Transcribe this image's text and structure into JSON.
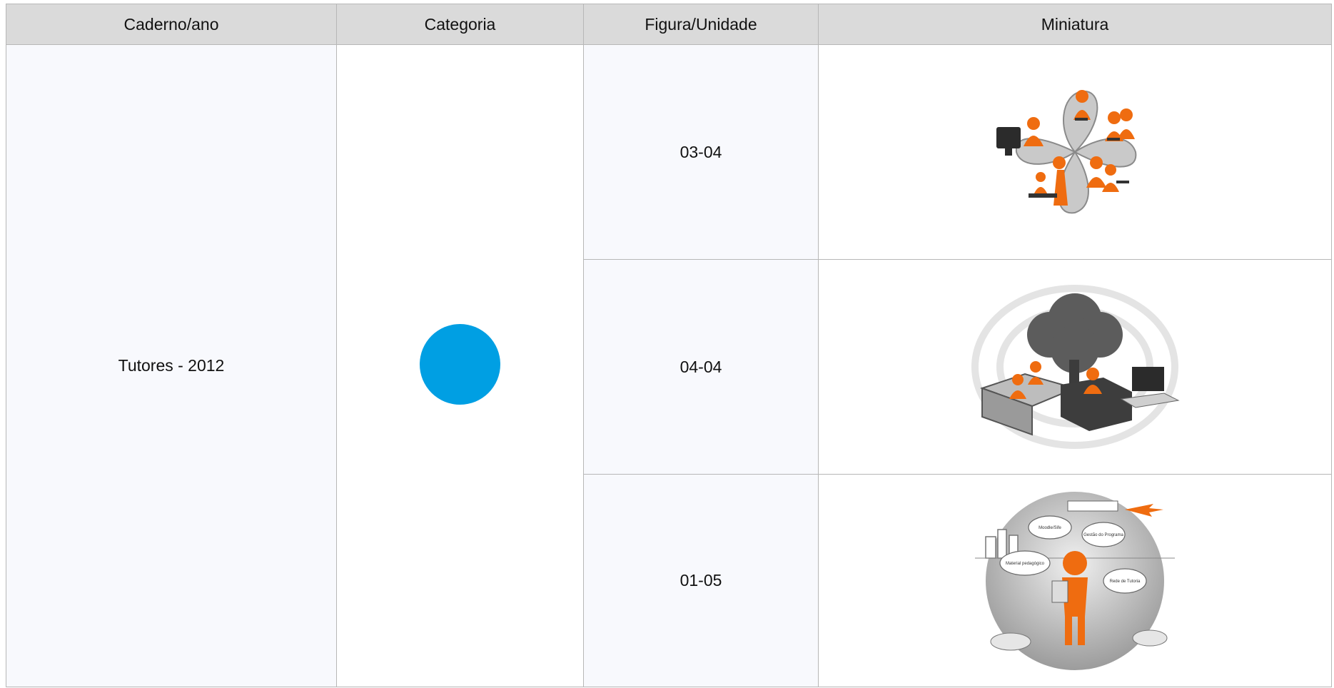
{
  "table": {
    "headers": [
      "Caderno/ano",
      "Categoria",
      "Figura/Unidade",
      "Miniatura"
    ],
    "caderno_ano": "Tutores - 2012",
    "category_color": "#009fe3",
    "rows": [
      {
        "figura": "03-04",
        "thumbnail": "people-network-illustration"
      },
      {
        "figura": "04-04",
        "thumbnail": "home-study-cloud-illustration"
      },
      {
        "figura": "01-05",
        "thumbnail": "student-thinking-globe-illustration",
        "bubble_texts": [
          "Moodle/Sife",
          "Gestão do Programa",
          "Material pedagógico",
          "Rede de Tutoria"
        ]
      }
    ]
  }
}
